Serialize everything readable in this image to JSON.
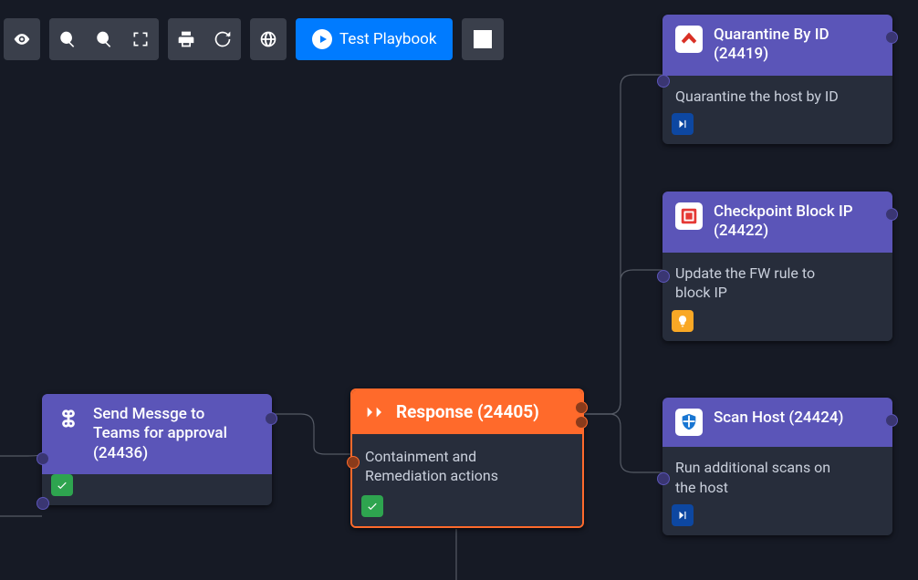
{
  "toolbar": {
    "test_label": "Test Playbook"
  },
  "nodes": {
    "teams": {
      "title_l1": "Send Messge to",
      "title_l2": "Teams for approval",
      "title_l3": "(24436)"
    },
    "response": {
      "title": "Response (24405)",
      "desc_l1": "Containment and",
      "desc_l2": "Remediation actions"
    },
    "quarantine": {
      "title_l1": "Quarantine By ID",
      "title_l2": "(24419)",
      "desc": "Quarantine the host by ID"
    },
    "checkpoint": {
      "title_l1": "Checkpoint Block IP",
      "title_l2": "(24422)",
      "desc_l1": "Update the FW rule to",
      "desc_l2": "block IP"
    },
    "scan": {
      "title": "Scan Host (24424)",
      "desc_l1": "Run additional scans on",
      "desc_l2": "the host"
    }
  }
}
